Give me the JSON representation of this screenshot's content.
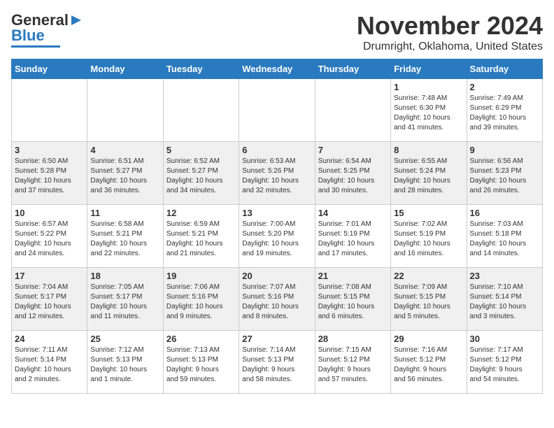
{
  "header": {
    "logo_general": "General",
    "logo_blue": "Blue",
    "title": "November 2024",
    "subtitle": "Drumright, Oklahoma, United States"
  },
  "days_of_week": [
    "Sunday",
    "Monday",
    "Tuesday",
    "Wednesday",
    "Thursday",
    "Friday",
    "Saturday"
  ],
  "weeks": [
    [
      {
        "day": "",
        "info": ""
      },
      {
        "day": "",
        "info": ""
      },
      {
        "day": "",
        "info": ""
      },
      {
        "day": "",
        "info": ""
      },
      {
        "day": "",
        "info": ""
      },
      {
        "day": "1",
        "info": "Sunrise: 7:48 AM\nSunset: 6:30 PM\nDaylight: 10 hours\nand 41 minutes."
      },
      {
        "day": "2",
        "info": "Sunrise: 7:49 AM\nSunset: 6:29 PM\nDaylight: 10 hours\nand 39 minutes."
      }
    ],
    [
      {
        "day": "3",
        "info": "Sunrise: 6:50 AM\nSunset: 5:28 PM\nDaylight: 10 hours\nand 37 minutes."
      },
      {
        "day": "4",
        "info": "Sunrise: 6:51 AM\nSunset: 5:27 PM\nDaylight: 10 hours\nand 36 minutes."
      },
      {
        "day": "5",
        "info": "Sunrise: 6:52 AM\nSunset: 5:27 PM\nDaylight: 10 hours\nand 34 minutes."
      },
      {
        "day": "6",
        "info": "Sunrise: 6:53 AM\nSunset: 5:26 PM\nDaylight: 10 hours\nand 32 minutes."
      },
      {
        "day": "7",
        "info": "Sunrise: 6:54 AM\nSunset: 5:25 PM\nDaylight: 10 hours\nand 30 minutes."
      },
      {
        "day": "8",
        "info": "Sunrise: 6:55 AM\nSunset: 5:24 PM\nDaylight: 10 hours\nand 28 minutes."
      },
      {
        "day": "9",
        "info": "Sunrise: 6:56 AM\nSunset: 5:23 PM\nDaylight: 10 hours\nand 26 minutes."
      }
    ],
    [
      {
        "day": "10",
        "info": "Sunrise: 6:57 AM\nSunset: 5:22 PM\nDaylight: 10 hours\nand 24 minutes."
      },
      {
        "day": "11",
        "info": "Sunrise: 6:58 AM\nSunset: 5:21 PM\nDaylight: 10 hours\nand 22 minutes."
      },
      {
        "day": "12",
        "info": "Sunrise: 6:59 AM\nSunset: 5:21 PM\nDaylight: 10 hours\nand 21 minutes."
      },
      {
        "day": "13",
        "info": "Sunrise: 7:00 AM\nSunset: 5:20 PM\nDaylight: 10 hours\nand 19 minutes."
      },
      {
        "day": "14",
        "info": "Sunrise: 7:01 AM\nSunset: 5:19 PM\nDaylight: 10 hours\nand 17 minutes."
      },
      {
        "day": "15",
        "info": "Sunrise: 7:02 AM\nSunset: 5:19 PM\nDaylight: 10 hours\nand 16 minutes."
      },
      {
        "day": "16",
        "info": "Sunrise: 7:03 AM\nSunset: 5:18 PM\nDaylight: 10 hours\nand 14 minutes."
      }
    ],
    [
      {
        "day": "17",
        "info": "Sunrise: 7:04 AM\nSunset: 5:17 PM\nDaylight: 10 hours\nand 12 minutes."
      },
      {
        "day": "18",
        "info": "Sunrise: 7:05 AM\nSunset: 5:17 PM\nDaylight: 10 hours\nand 11 minutes."
      },
      {
        "day": "19",
        "info": "Sunrise: 7:06 AM\nSunset: 5:16 PM\nDaylight: 10 hours\nand 9 minutes."
      },
      {
        "day": "20",
        "info": "Sunrise: 7:07 AM\nSunset: 5:16 PM\nDaylight: 10 hours\nand 8 minutes."
      },
      {
        "day": "21",
        "info": "Sunrise: 7:08 AM\nSunset: 5:15 PM\nDaylight: 10 hours\nand 6 minutes."
      },
      {
        "day": "22",
        "info": "Sunrise: 7:09 AM\nSunset: 5:15 PM\nDaylight: 10 hours\nand 5 minutes."
      },
      {
        "day": "23",
        "info": "Sunrise: 7:10 AM\nSunset: 5:14 PM\nDaylight: 10 hours\nand 3 minutes."
      }
    ],
    [
      {
        "day": "24",
        "info": "Sunrise: 7:11 AM\nSunset: 5:14 PM\nDaylight: 10 hours\nand 2 minutes."
      },
      {
        "day": "25",
        "info": "Sunrise: 7:12 AM\nSunset: 5:13 PM\nDaylight: 10 hours\nand 1 minute."
      },
      {
        "day": "26",
        "info": "Sunrise: 7:13 AM\nSunset: 5:13 PM\nDaylight: 9 hours\nand 59 minutes."
      },
      {
        "day": "27",
        "info": "Sunrise: 7:14 AM\nSunset: 5:13 PM\nDaylight: 9 hours\nand 58 minutes."
      },
      {
        "day": "28",
        "info": "Sunrise: 7:15 AM\nSunset: 5:12 PM\nDaylight: 9 hours\nand 57 minutes."
      },
      {
        "day": "29",
        "info": "Sunrise: 7:16 AM\nSunset: 5:12 PM\nDaylight: 9 hours\nand 56 minutes."
      },
      {
        "day": "30",
        "info": "Sunrise: 7:17 AM\nSunset: 5:12 PM\nDaylight: 9 hours\nand 54 minutes."
      }
    ]
  ]
}
